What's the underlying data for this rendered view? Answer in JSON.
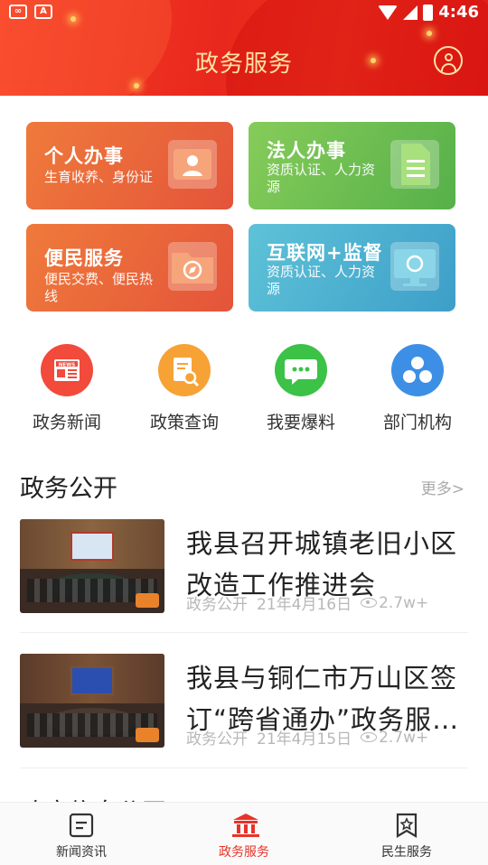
{
  "status_bar": {
    "time": "4:46"
  },
  "header": {
    "title": "政务服务"
  },
  "service_cards": [
    {
      "title": "个人办事",
      "subtitle": "生育收养、身份证",
      "icon": "id-card-icon",
      "color": "#e96a3a"
    },
    {
      "title": "法人办事",
      "subtitle": "资质认证、人力资源",
      "icon": "document-icon",
      "color": "#6cbd50"
    },
    {
      "title": "便民服务",
      "subtitle": "便民交费、便民热线",
      "icon": "folder-compass-icon",
      "color": "#e96a3a"
    },
    {
      "title": "互联网+监督",
      "subtitle": "资质认证、人力资源",
      "icon": "monitor-icon",
      "color": "#4aaed0"
    }
  ],
  "quick_entries": [
    {
      "label": "政务新闻",
      "icon": "news-icon",
      "color": "#f24a3b"
    },
    {
      "label": "政策查询",
      "icon": "policy-search-icon",
      "color": "#f6a235"
    },
    {
      "label": "我要爆料",
      "icon": "chat-bubble-icon",
      "color": "#3bc247"
    },
    {
      "label": "部门机构",
      "icon": "organization-icon",
      "color": "#3d8fe6"
    }
  ],
  "section": {
    "title": "政务公开",
    "more": "更多>"
  },
  "news": [
    {
      "title": "我县召开城镇老旧小区改造工作推进会",
      "category": "政务公开",
      "date": "21年4月16日",
      "views": "2.7w+"
    },
    {
      "title": "我县与铜仁市万山区签订“跨省通办”政务服务合作协议",
      "category": "政务公开",
      "date": "21年4月15日",
      "views": "2.7w+"
    }
  ],
  "next_section": {
    "title": "政府信息公开"
  },
  "bottom_nav": [
    {
      "label": "新闻资讯",
      "icon": "news-tab-icon"
    },
    {
      "label": "政务服务",
      "icon": "government-building-icon",
      "active": true
    },
    {
      "label": "民生服务",
      "icon": "star-badge-icon"
    }
  ]
}
